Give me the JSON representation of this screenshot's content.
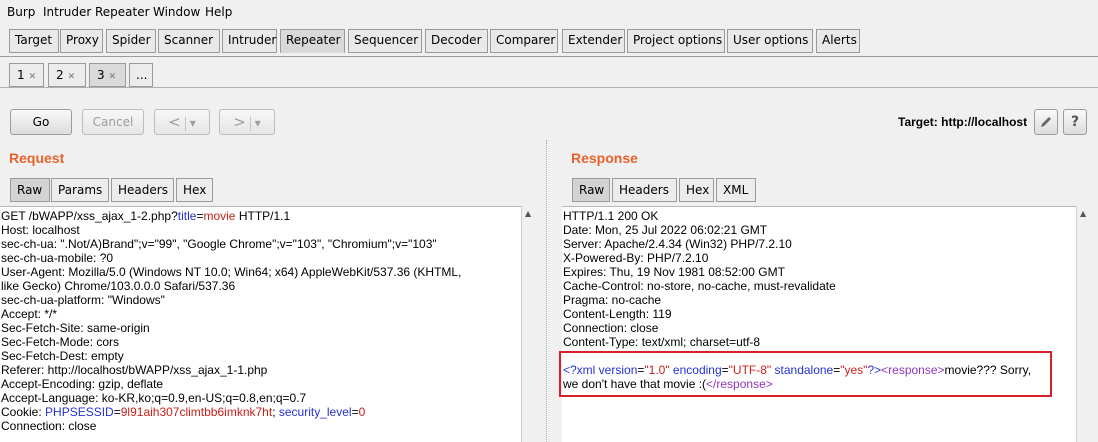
{
  "menu": [
    "Burp",
    "Intruder",
    "Repeater",
    "Window",
    "Help"
  ],
  "main_tabs": [
    "Target",
    "Proxy",
    "Spider",
    "Scanner",
    "Intruder",
    "Repeater",
    "Sequencer",
    "Decoder",
    "Comparer",
    "Extender",
    "Project options",
    "User options",
    "Alerts"
  ],
  "active_main_tab": "Repeater",
  "sub_tabs": [
    "1",
    "2",
    "3",
    "..."
  ],
  "active_sub_tab": "3",
  "toolbar": {
    "go": "Go",
    "cancel": "Cancel",
    "back": "<",
    "forward": ">",
    "dropdown": "▾",
    "target_label": "Target: http://localhost",
    "edit_icon": "pencil-icon",
    "help_icon": "help-icon",
    "help_glyph": "?"
  },
  "request": {
    "title": "Request",
    "tabs": [
      "Raw",
      "Params",
      "Headers",
      "Hex"
    ],
    "active_tab": "Raw",
    "line1": {
      "a": "GET /bWAPP/xss_ajax_1-2.php?",
      "param_name": "title",
      "eq": "=",
      "param_value": "movie",
      "b": " HTTP/1.1"
    },
    "lines": [
      "Host: localhost",
      "sec-ch-ua: \".Not/A)Brand\";v=\"99\", \"Google Chrome\";v=\"103\", \"Chromium\";v=\"103\"",
      "sec-ch-ua-mobile: ?0",
      "User-Agent: Mozilla/5.0 (Windows NT 10.0; Win64; x64) AppleWebKit/537.36 (KHTML,",
      "like Gecko) Chrome/103.0.0.0 Safari/537.36",
      "sec-ch-ua-platform: \"Windows\"",
      "Accept: */*",
      "Sec-Fetch-Site: same-origin",
      "Sec-Fetch-Mode: cors",
      "Sec-Fetch-Dest: empty",
      "Referer: http://localhost/bWAPP/xss_ajax_1-1.php",
      "Accept-Encoding: gzip, deflate",
      "Accept-Language: ko-KR,ko;q=0.9,en-US;q=0.8,en;q=0.7"
    ],
    "cookie": {
      "prefix": "Cookie: ",
      "k1": "PHPSESSID",
      "eq1": "=",
      "v1": "9l91aih307climtbb6imknk7ht",
      "sep": "; ",
      "k2": "security_level",
      "eq2": "=",
      "v2": "0"
    },
    "last_line": "Connection: close"
  },
  "response": {
    "title": "Response",
    "tabs": [
      "Raw",
      "Headers",
      "Hex",
      "XML"
    ],
    "active_tab": "Raw",
    "lines": [
      "HTTP/1.1 200 OK",
      "Date: Mon, 25 Jul 2022 06:02:21 GMT",
      "Server: Apache/2.4.34 (Win32) PHP/7.2.10",
      "X-Powered-By: PHP/7.2.10",
      "Expires: Thu, 19 Nov 1981 08:52:00 GMT",
      "Cache-Control: no-store, no-cache, must-revalidate",
      "Pragma: no-cache",
      "Content-Length: 119",
      "Connection: close",
      "Content-Type: text/xml; charset=utf-8"
    ],
    "xml": {
      "pi_open": "<?xml",
      "a1": " version",
      "eq": "=",
      "v1": "\"1.0\"",
      "a2": " encoding",
      "v2": "\"UTF-8\"",
      "a3": " standalone",
      "v3": "\"yes\"",
      "pi_close": "?>",
      "lt": "<",
      "tag": "response",
      "gt": ">",
      "text1": "movie??? Sorry,",
      "text2": "we don't have that movie :(",
      "close_lt": "</",
      "close_gt": ">"
    }
  },
  "colors": {
    "accent": "#e8632b",
    "highlight_box": "#d6202a",
    "param_name": "#2532d2",
    "param_value": "#c8201a",
    "xml_tag": "#8e36b9"
  }
}
